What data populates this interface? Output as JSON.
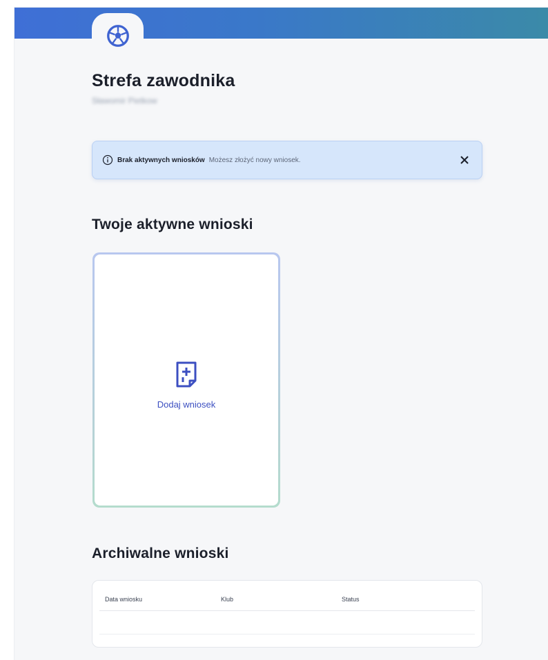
{
  "header": {
    "logo_icon": "football-icon",
    "gradient_start": "#3f6fd6",
    "gradient_end": "#3b8aa8"
  },
  "page": {
    "title": "Strefa zawodnika",
    "subtitle": "Sławomir Pietkow"
  },
  "alert": {
    "icon": "info-icon",
    "title": "Brak aktywnych wniosków",
    "message": "Możesz złożyć nowy wniosek.",
    "close_icon": "close-icon",
    "background": "#d6e6fb"
  },
  "active_section": {
    "title": "Twoje aktywne wnioski",
    "add_card": {
      "icon": "document-plus-icon",
      "label": "Dodaj wniosek",
      "accent": "#3c4fc1"
    }
  },
  "archive_section": {
    "title": "Archiwalne wnioski",
    "table": {
      "columns": [
        "Data wniosku",
        "Klub",
        "Status"
      ],
      "rows": [
        []
      ]
    }
  }
}
